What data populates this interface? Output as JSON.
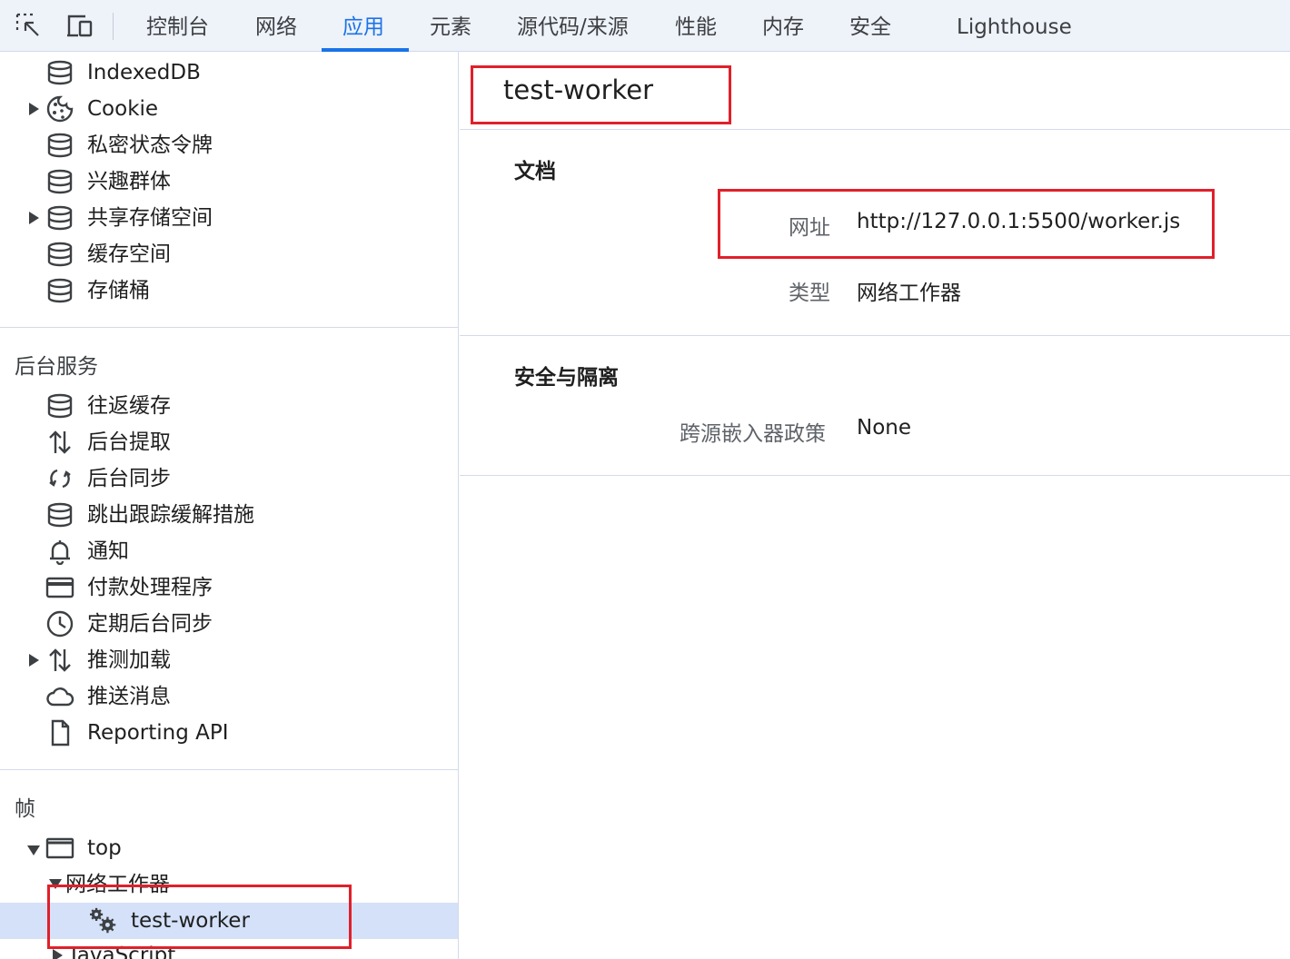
{
  "toolbar": {
    "tabs": [
      "控制台",
      "网络",
      "应用",
      "元素",
      "源代码/来源",
      "性能",
      "内存",
      "安全",
      "Lighthouse"
    ],
    "active_tab": "应用",
    "accent_color": "#1a73e8"
  },
  "sidebar": {
    "storage_items": [
      {
        "label": "IndexedDB",
        "icon": "database-icon",
        "expandable": false
      },
      {
        "label": "Cookie",
        "icon": "cookie-icon",
        "expandable": true
      },
      {
        "label": "私密状态令牌",
        "icon": "database-icon",
        "expandable": false
      },
      {
        "label": "兴趣群体",
        "icon": "database-icon",
        "expandable": false
      },
      {
        "label": "共享存储空间",
        "icon": "database-icon",
        "expandable": true
      },
      {
        "label": "缓存空间",
        "icon": "database-icon",
        "expandable": false
      },
      {
        "label": "存储桶",
        "icon": "database-icon",
        "expandable": false
      }
    ],
    "background_title": "后台服务",
    "background_items": [
      {
        "label": "往返缓存",
        "icon": "database-icon"
      },
      {
        "label": "后台提取",
        "icon": "up-down-arrows-icon"
      },
      {
        "label": "后台同步",
        "icon": "sync-icon"
      },
      {
        "label": "跳出跟踪缓解措施",
        "icon": "database-icon"
      },
      {
        "label": "通知",
        "icon": "bell-icon"
      },
      {
        "label": "付款处理程序",
        "icon": "credit-card-icon"
      },
      {
        "label": "定期后台同步",
        "icon": "clock-icon"
      },
      {
        "label": "推测加载",
        "icon": "up-down-arrows-icon"
      },
      {
        "label": "推送消息",
        "icon": "cloud-icon"
      },
      {
        "label": "Reporting API",
        "icon": "file-icon"
      }
    ],
    "frames_title": "帧",
    "frame_top": "top",
    "frame_workers": "网络工作器",
    "frame_worker_item": "test-worker",
    "frame_javascript": "JavaScript"
  },
  "main": {
    "title": "test-worker",
    "doc_section": "文档",
    "url_key": "网址",
    "url_value": "http://127.0.0.1:5500/worker.js",
    "type_key": "类型",
    "type_value": "网络工作器",
    "security_section": "安全与隔离",
    "coep_key": "跨源嵌入器政策",
    "coep_value": "None"
  },
  "highlight_color": "#e0202a"
}
